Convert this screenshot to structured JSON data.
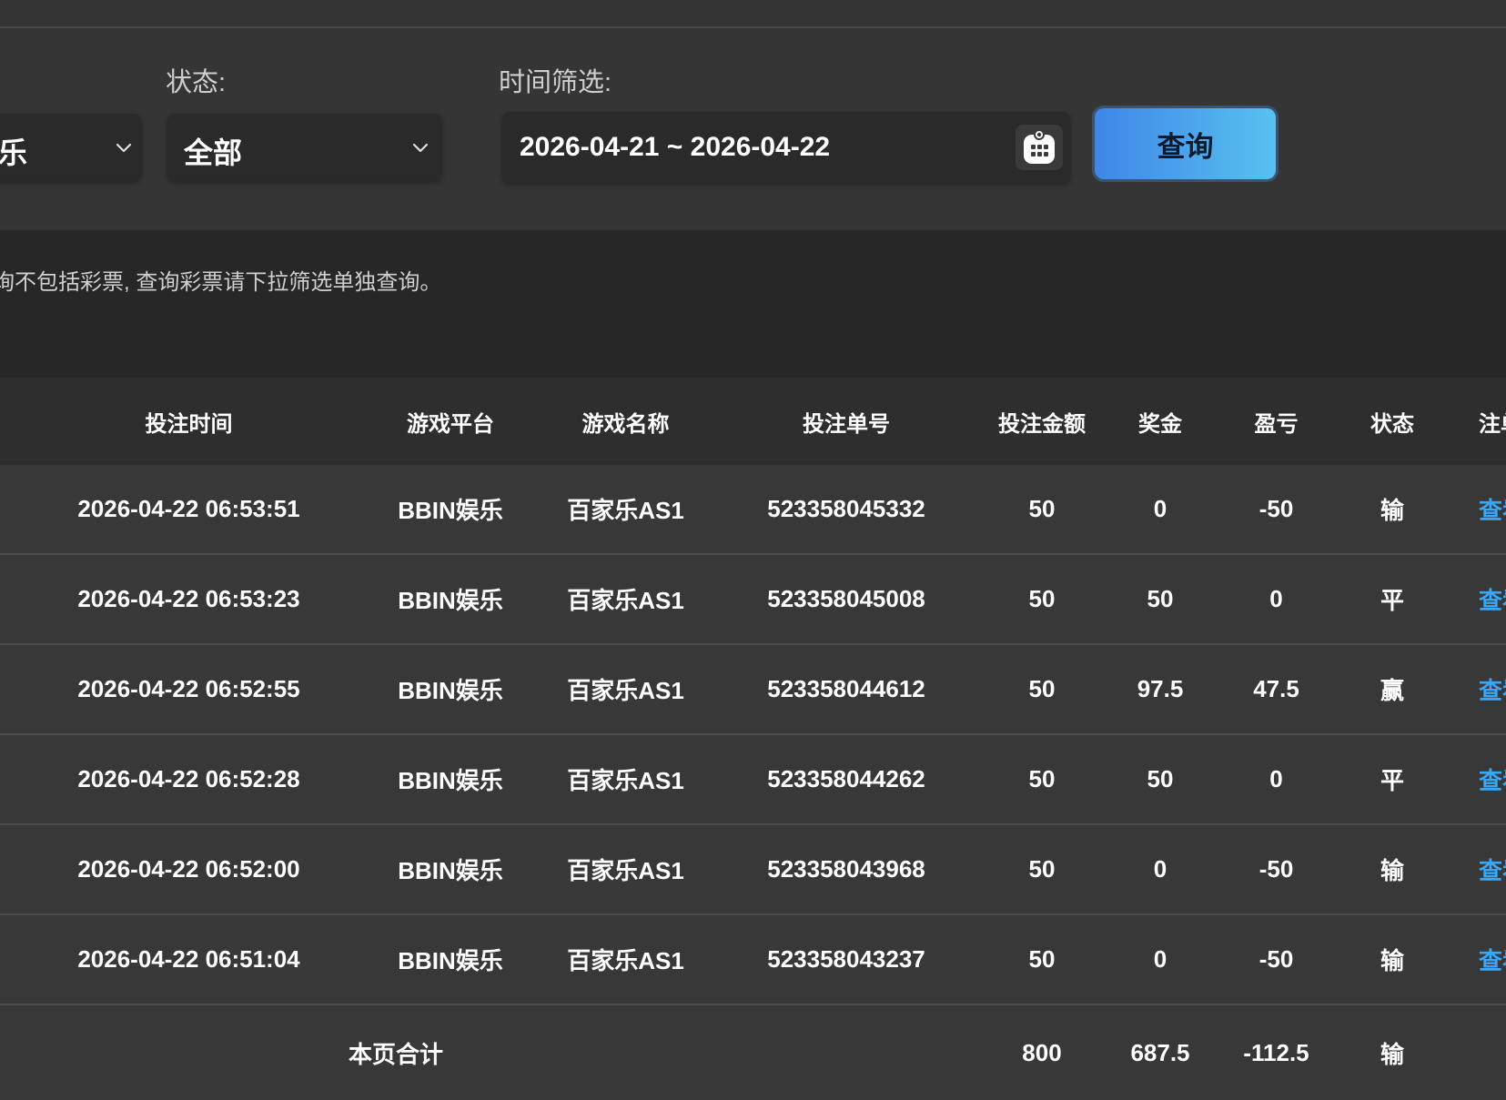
{
  "filters": {
    "platform_value_partial": "乐",
    "status_label": "状态:",
    "status_value": "全部",
    "time_label": "时间筛选:",
    "date_range": "2026-04-21 ~ 2026-04-22",
    "query_button": "查询"
  },
  "notice": {
    "text": "询不包括彩票, 查询彩票请下拉筛选单独查询。"
  },
  "table": {
    "headers": [
      "投注时间",
      "游戏平台",
      "游戏名称",
      "投注单号",
      "投注金额",
      "奖金",
      "盈亏",
      "状态",
      "注单"
    ],
    "rows": [
      {
        "time": "2026-04-22 06:53:51",
        "platform": "BBIN娱乐",
        "game": "百家乐AS1",
        "order": "523358045332",
        "amount": "50",
        "bonus": "0",
        "profit": "-50",
        "status": "输",
        "action": "查看"
      },
      {
        "time": "2026-04-22 06:53:23",
        "platform": "BBIN娱乐",
        "game": "百家乐AS1",
        "order": "523358045008",
        "amount": "50",
        "bonus": "50",
        "profit": "0",
        "status": "平",
        "action": "查看"
      },
      {
        "time": "2026-04-22 06:52:55",
        "platform": "BBIN娱乐",
        "game": "百家乐AS1",
        "order": "523358044612",
        "amount": "50",
        "bonus": "97.5",
        "profit": "47.5",
        "status": "赢",
        "action": "查看"
      },
      {
        "time": "2026-04-22 06:52:28",
        "platform": "BBIN娱乐",
        "game": "百家乐AS1",
        "order": "523358044262",
        "amount": "50",
        "bonus": "50",
        "profit": "0",
        "status": "平",
        "action": "查看"
      },
      {
        "time": "2026-04-22 06:52:00",
        "platform": "BBIN娱乐",
        "game": "百家乐AS1",
        "order": "523358043968",
        "amount": "50",
        "bonus": "0",
        "profit": "-50",
        "status": "输",
        "action": "查看"
      },
      {
        "time": "2026-04-22 06:51:04",
        "platform": "BBIN娱乐",
        "game": "百家乐AS1",
        "order": "523358043237",
        "amount": "50",
        "bonus": "0",
        "profit": "-50",
        "status": "输",
        "action": "查看"
      }
    ],
    "total": {
      "label": "本页合计",
      "amount": "800",
      "bonus": "687.5",
      "profit": "-112.5",
      "status": "输"
    }
  },
  "colors": {
    "background": "#343434",
    "accent_link": "#3aa6f5",
    "query_button_start": "#3f86e8",
    "query_button_end": "#58c1ef"
  },
  "icons": [
    "chevron-down-icon",
    "calendar-icon"
  ]
}
